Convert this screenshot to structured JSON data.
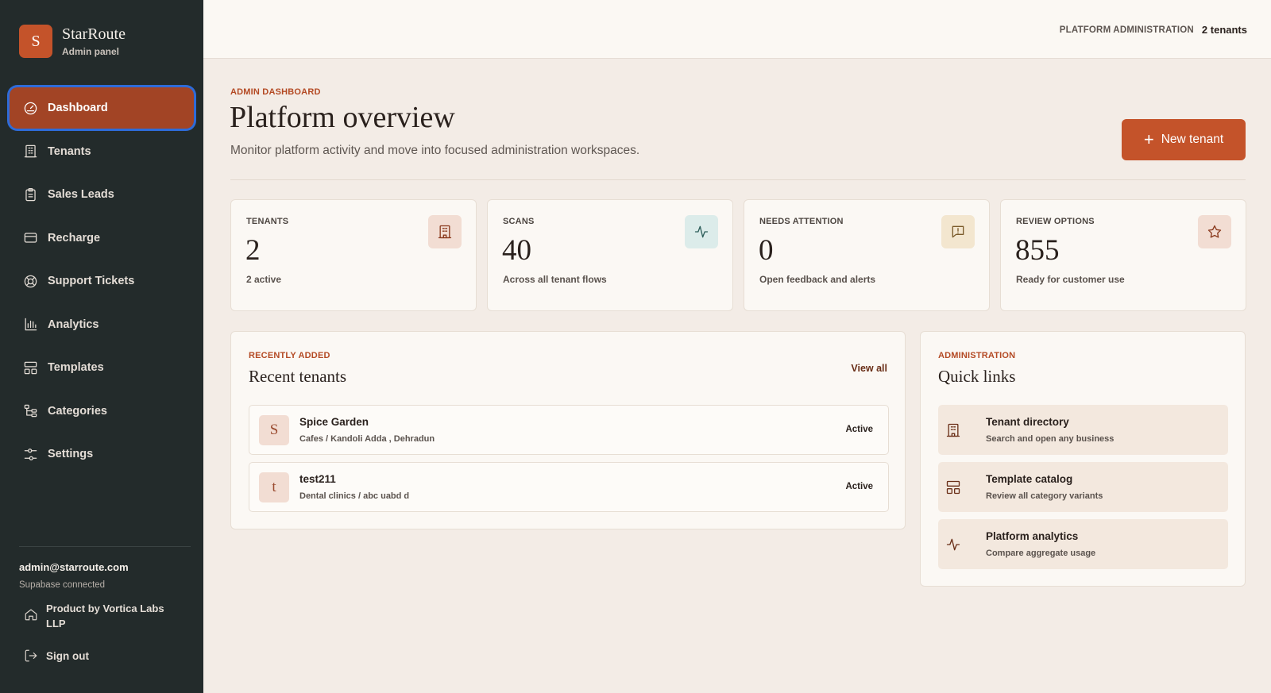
{
  "brand": {
    "initial": "S",
    "name": "StarRoute",
    "subtitle": "Admin panel"
  },
  "nav": {
    "items": [
      {
        "label": "Dashboard",
        "icon": "gauge-icon",
        "active": true
      },
      {
        "label": "Tenants",
        "icon": "building-icon"
      },
      {
        "label": "Sales Leads",
        "icon": "clipboard-icon"
      },
      {
        "label": "Recharge",
        "icon": "credit-card-icon"
      },
      {
        "label": "Support Tickets",
        "icon": "lifebuoy-icon"
      },
      {
        "label": "Analytics",
        "icon": "bar-chart-icon"
      },
      {
        "label": "Templates",
        "icon": "layout-icon"
      },
      {
        "label": "Categories",
        "icon": "tree-icon"
      },
      {
        "label": "Settings",
        "icon": "sliders-icon"
      }
    ]
  },
  "sidebar_footer": {
    "email": "admin@starroute.com",
    "status": "Supabase connected",
    "vendor": "Product by Vortica Labs LLP",
    "sign_out": "Sign out"
  },
  "topbar": {
    "label": "PLATFORM ADMINISTRATION",
    "count": "2 tenants"
  },
  "header": {
    "eyebrow": "ADMIN DASHBOARD",
    "title": "Platform overview",
    "subtitle": "Monitor platform activity and move into focused administration workspaces.",
    "new_button": "New tenant"
  },
  "stats": [
    {
      "label": "TENANTS",
      "value": "2",
      "sub": "2 active",
      "icon": "building-icon",
      "icon_bg": "#f2ddd3",
      "icon_color": "#8a3a1e"
    },
    {
      "label": "SCANS",
      "value": "40",
      "sub": "Across all tenant flows",
      "icon": "activity-icon",
      "icon_bg": "#dcecea",
      "icon_color": "#2d5e5a"
    },
    {
      "label": "NEEDS ATTENTION",
      "value": "0",
      "sub": "Open feedback and alerts",
      "icon": "message-alert-icon",
      "icon_bg": "#f3e6cf",
      "icon_color": "#7a5a2a"
    },
    {
      "label": "REVIEW OPTIONS",
      "value": "855",
      "sub": "Ready for customer use",
      "icon": "star-icon",
      "icon_bg": "#f2ddd3",
      "icon_color": "#8a3a1e"
    }
  ],
  "recent": {
    "eyebrow": "RECENTLY ADDED",
    "title": "Recent tenants",
    "view_all": "View all",
    "rows": [
      {
        "initial": "S",
        "name": "Spice Garden",
        "meta": "Cafes / Kandoli Adda , Dehradun",
        "status": "Active"
      },
      {
        "initial": "t",
        "name": "test211",
        "meta": "Dental clinics / abc uabd d",
        "status": "Active"
      }
    ]
  },
  "quick": {
    "eyebrow": "ADMINISTRATION",
    "title": "Quick links",
    "items": [
      {
        "title": "Tenant directory",
        "sub": "Search and open any business",
        "icon": "building-icon"
      },
      {
        "title": "Template catalog",
        "sub": "Review all category variants",
        "icon": "layout-icon"
      },
      {
        "title": "Platform analytics",
        "sub": "Compare aggregate usage",
        "icon": "activity-icon"
      }
    ]
  }
}
